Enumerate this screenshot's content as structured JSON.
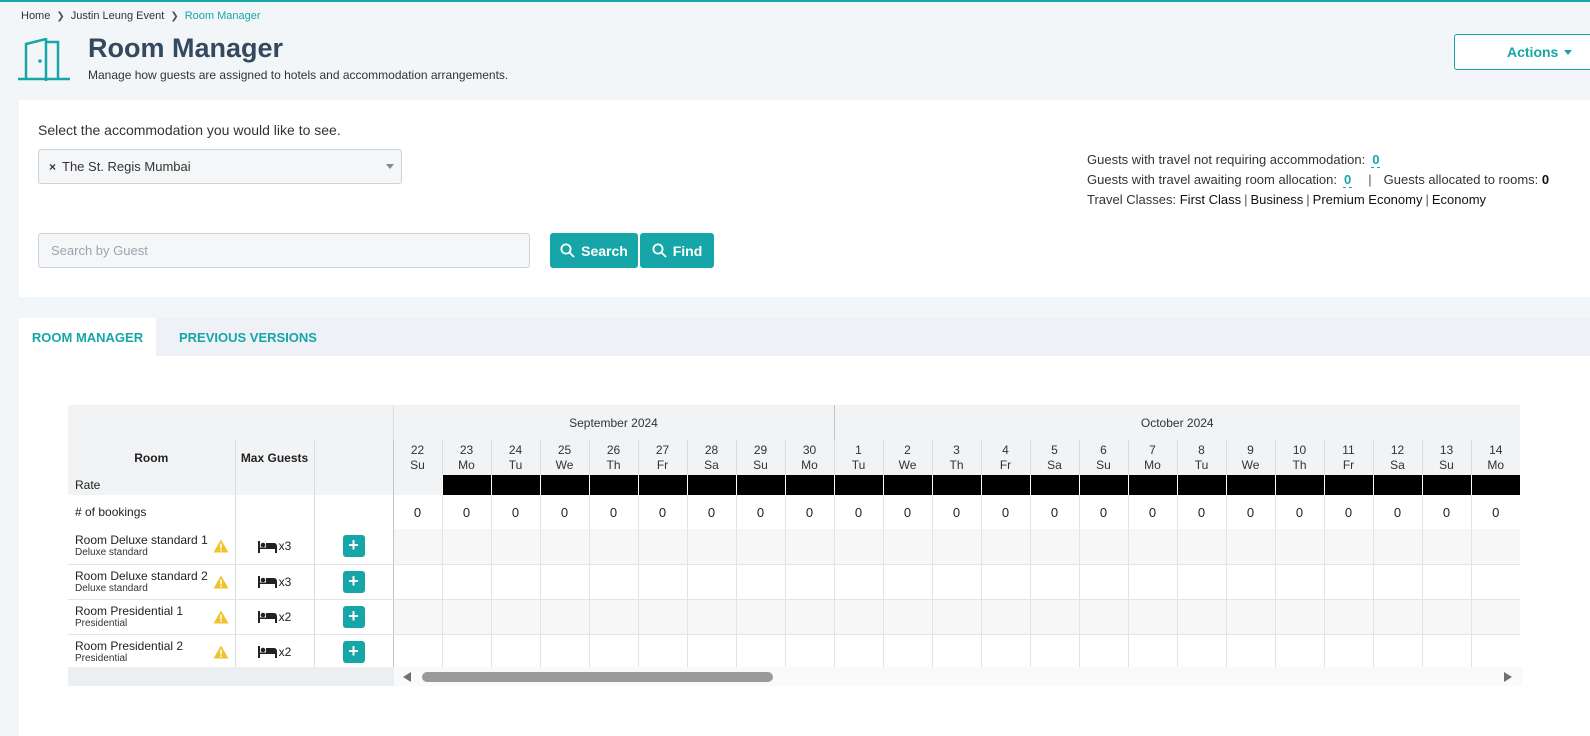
{
  "breadcrumb": {
    "home": "Home",
    "event": "Justin Leung Event",
    "current": "Room Manager"
  },
  "header": {
    "title": "Room Manager",
    "subtitle": "Manage how guests are assigned to hotels and accommodation arrangements.",
    "actions_label": "Actions"
  },
  "filter": {
    "select_label": "Select the accommodation you would like to see.",
    "selected_tag": "The St. Regis Mumbai",
    "remove_symbol": "×",
    "search_placeholder": "Search by Guest",
    "search_label": "Search",
    "find_label": "Find"
  },
  "stats": {
    "not_requiring_label": "Guests with travel not requiring accommodation:",
    "not_requiring_value": "0",
    "awaiting_label": "Guests with travel awaiting room allocation:",
    "awaiting_value": "0",
    "pipe": "|",
    "allocated_label": "Guests allocated to rooms:",
    "allocated_value": "0",
    "travel_classes_label": "Travel Classes:",
    "travel_classes": [
      "First Class",
      "Business",
      "Premium Economy",
      "Economy"
    ]
  },
  "tabs": {
    "room_manager": "ROOM MANAGER",
    "previous_versions": "PREVIOUS VERSIONS"
  },
  "grid": {
    "months": [
      {
        "name": "September 2024",
        "span": 9
      },
      {
        "name": "October 2024",
        "span": 14
      }
    ],
    "col_room": "Room",
    "col_max_guests": "Max Guests",
    "rate_label": "Rate",
    "bookings_label": "# of bookings",
    "days": [
      {
        "num": "22",
        "dow": "Su"
      },
      {
        "num": "23",
        "dow": "Mo"
      },
      {
        "num": "24",
        "dow": "Tu"
      },
      {
        "num": "25",
        "dow": "We"
      },
      {
        "num": "26",
        "dow": "Th"
      },
      {
        "num": "27",
        "dow": "Fr"
      },
      {
        "num": "28",
        "dow": "Sa"
      },
      {
        "num": "29",
        "dow": "Su"
      },
      {
        "num": "30",
        "dow": "Mo"
      },
      {
        "num": "1",
        "dow": "Tu"
      },
      {
        "num": "2",
        "dow": "We"
      },
      {
        "num": "3",
        "dow": "Th"
      },
      {
        "num": "4",
        "dow": "Fr"
      },
      {
        "num": "5",
        "dow": "Sa"
      },
      {
        "num": "6",
        "dow": "Su"
      },
      {
        "num": "7",
        "dow": "Mo"
      },
      {
        "num": "8",
        "dow": "Tu"
      },
      {
        "num": "9",
        "dow": "We"
      },
      {
        "num": "10",
        "dow": "Th"
      },
      {
        "num": "11",
        "dow": "Fr"
      },
      {
        "num": "12",
        "dow": "Sa"
      },
      {
        "num": "13",
        "dow": "Su"
      },
      {
        "num": "14",
        "dow": "Mo"
      }
    ],
    "rate_filled": [
      false,
      true,
      true,
      true,
      true,
      true,
      true,
      true,
      true,
      true,
      true,
      true,
      true,
      true,
      true,
      true,
      true,
      true,
      true,
      true,
      true,
      true,
      true
    ],
    "bookings": [
      "0",
      "0",
      "0",
      "0",
      "0",
      "0",
      "0",
      "0",
      "0",
      "0",
      "0",
      "0",
      "0",
      "0",
      "0",
      "0",
      "0",
      "0",
      "0",
      "0",
      "0",
      "0",
      "0"
    ],
    "rooms": [
      {
        "name": "Room Deluxe standard 1",
        "type": "Deluxe standard",
        "max": "x3"
      },
      {
        "name": "Room Deluxe standard 2",
        "type": "Deluxe standard",
        "max": "x3"
      },
      {
        "name": "Room Presidential 1",
        "type": "Presidential",
        "max": "x2"
      },
      {
        "name": "Room Presidential 2",
        "type": "Presidential",
        "max": "x2"
      }
    ],
    "add_symbol": "+"
  },
  "colors": {
    "accent": "#17a6a8",
    "rate_bar": "#000000",
    "warning": "#f0c22e"
  }
}
